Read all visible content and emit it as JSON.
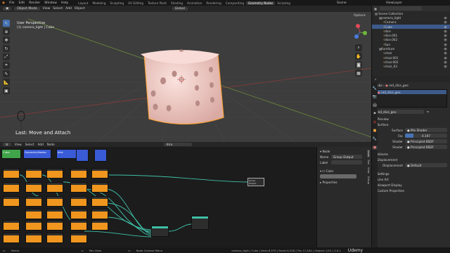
{
  "topbar": {
    "menus": [
      "File",
      "Edit",
      "Render",
      "Window",
      "Help"
    ],
    "tabs": [
      "Layout",
      "Modeling",
      "Sculpting",
      "UV Editing",
      "Texture Paint",
      "Shading",
      "Animation",
      "Rendering",
      "Compositing",
      "Geometry Nodes",
      "Scripting"
    ],
    "active_tab": "Geometry Nodes",
    "scene": "Scene",
    "view_layer": "ViewLayer"
  },
  "viewport": {
    "mode": "Object Mode",
    "menus": [
      "View",
      "Select",
      "Add",
      "Object"
    ],
    "orientation": "Global",
    "title": "User Perspective",
    "subtitle": "(1) camera_light | Cube",
    "last_op": "Last: Move and Attach",
    "options": "Options"
  },
  "node_editor": {
    "menus": [
      "View",
      "Select",
      "Add",
      "Node"
    ],
    "tree_name": "dice",
    "breadcrumbs": [
      "Cube",
      "GeometryNodes",
      "disk"
    ],
    "group_output": "Group Output",
    "panel": {
      "section": "Node",
      "name_label": "Name",
      "name_value": "Group Output",
      "label_label": "Label",
      "color_label": "Color",
      "properties_label": "Properties",
      "tabs": [
        "Node",
        "Tool",
        "View",
        "Group"
      ]
    }
  },
  "outliner": {
    "title": "Scene Collection",
    "items": [
      {
        "name": "camera_light",
        "depth": 1
      },
      {
        "name": "Camera",
        "depth": 2
      },
      {
        "name": "Cube",
        "depth": 2,
        "selected": true
      },
      {
        "name": "dice",
        "depth": 2
      },
      {
        "name": "dice.001",
        "depth": 2
      },
      {
        "name": "dice.002",
        "depth": 2
      },
      {
        "name": "Sun",
        "depth": 2
      },
      {
        "name": "furniture",
        "depth": 1
      },
      {
        "name": "chair",
        "depth": 2
      },
      {
        "name": "chair.001",
        "depth": 2
      },
      {
        "name": "chair.002",
        "depth": 2
      },
      {
        "name": "chair_03",
        "depth": 2
      }
    ]
  },
  "properties": {
    "object": "Cube",
    "material": "red_dice_geo",
    "material_slot": "red_dice_geo",
    "material_field": "red_dice_geo",
    "sections": {
      "preview": "Preview",
      "surface": "Surface",
      "volume": "Volume",
      "displacement": "Displacement",
      "settings": "Settings",
      "line_art": "Line Art",
      "viewport_display": "Viewport Display",
      "custom_properties": "Custom Properties"
    },
    "surface_label": "Surface",
    "surface_value": "Mix Shader",
    "fac_label": "Fac",
    "fac_value": "0.197",
    "shader1_label": "Shader",
    "shader1_value": "Principled BSDF",
    "shader2_label": "Shader",
    "shader2_value": "Principled BSDF",
    "disp_label": "Displacement",
    "disp_value": "Default"
  },
  "statusbar": {
    "select": "Select",
    "pan": "Pan View",
    "context": "Node Context Menu",
    "stats": "camera_light | Cube | Verts 8,570 | Faces 8,256 | Tris 17,404 | Objects 1/15 | 3.6.1",
    "watermark": "Udemy"
  },
  "colors": {
    "accent": "#4772b3",
    "node_orange": "#f0961e",
    "node_link": "#3fbfa6",
    "dice": "#f3cdc7",
    "selection": "#f7a13d"
  }
}
